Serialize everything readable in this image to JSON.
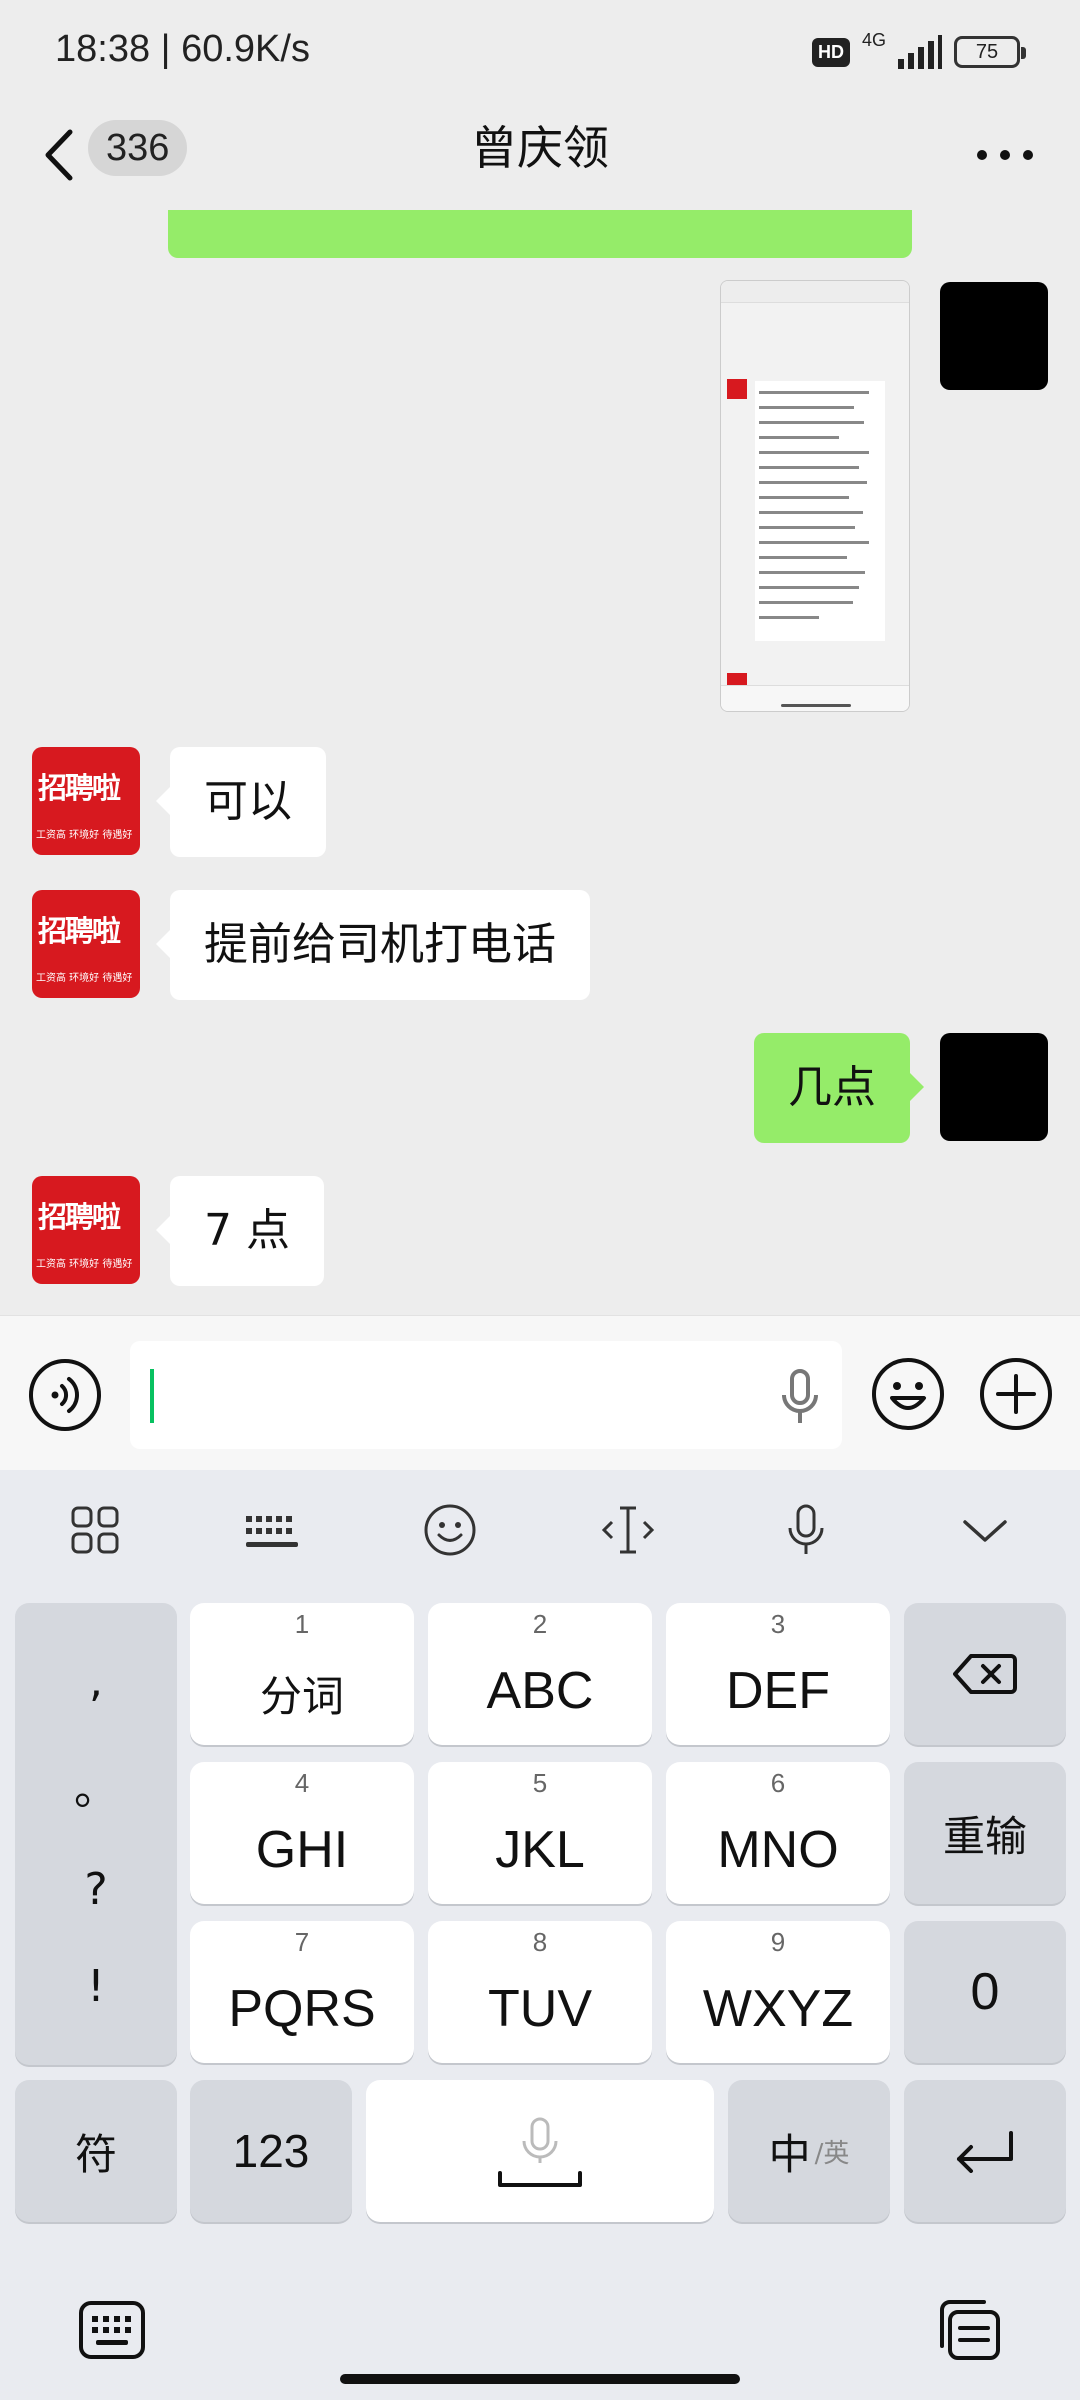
{
  "status_bar": {
    "time": "18:38 | 60.9K/s",
    "hd": "HD",
    "network": "4G",
    "battery": "75"
  },
  "nav": {
    "unread_count": "336",
    "title": "曾庆领"
  },
  "messages": [
    {
      "from": "self",
      "type": "image"
    },
    {
      "from": "other",
      "text": "可以"
    },
    {
      "from": "other",
      "text": "提前给司机打电话"
    },
    {
      "from": "self",
      "text": "几点"
    },
    {
      "from": "other",
      "text": "7 点"
    }
  ],
  "avatar_other": {
    "logo_main": "招聘啦",
    "logo_sub": "工资高 环境好 待遇好"
  },
  "keyboard": {
    "punct": [
      ",",
      "。",
      "?",
      "!"
    ],
    "keys": [
      {
        "num": "1",
        "label": "分词"
      },
      {
        "num": "2",
        "label": "ABC"
      },
      {
        "num": "3",
        "label": "DEF"
      },
      {
        "num": "4",
        "label": "GHI"
      },
      {
        "num": "5",
        "label": "JKL"
      },
      {
        "num": "6",
        "label": "MNO"
      },
      {
        "num": "7",
        "label": "PQRS"
      },
      {
        "num": "8",
        "label": "TUV"
      },
      {
        "num": "9",
        "label": "WXYZ"
      }
    ],
    "reinput": "重输",
    "zero": "0",
    "symbols": "符",
    "numbers": "123",
    "lang_main": "中",
    "lang_sub": "/英"
  },
  "icons": {
    "back": "chevron-left-icon",
    "more": "more-dots-icon",
    "voice": "voice-icon",
    "emoji": "emoji-icon",
    "plus": "plus-icon"
  }
}
